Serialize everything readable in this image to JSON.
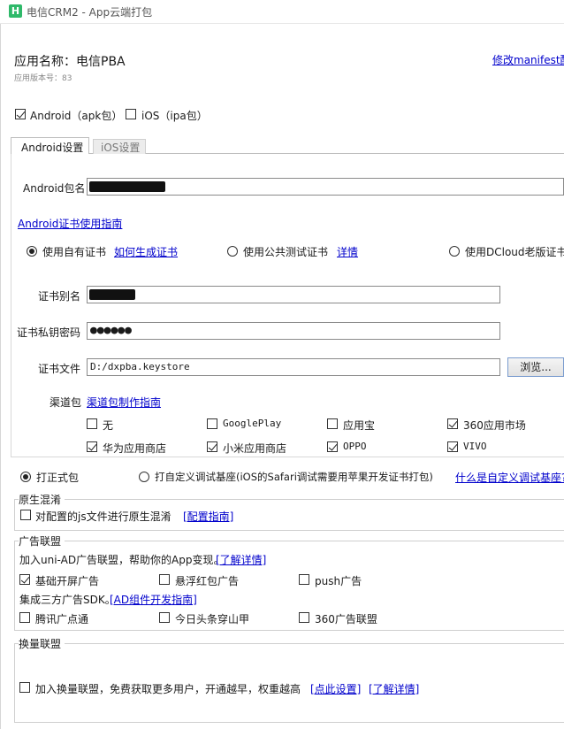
{
  "window": {
    "title": "电信CRM2 - App云端打包",
    "logo_letter": "H"
  },
  "header": {
    "app_name": "应用名称：电信PBA",
    "version": "应用版本号：83",
    "manifest_link": "修改manifest配置"
  },
  "platforms": {
    "android": {
      "label": "Android（apk包）",
      "checked": true
    },
    "ios": {
      "label": "iOS（ipa包）",
      "checked": false
    }
  },
  "tabs": [
    {
      "label": "Android设置",
      "active": true
    },
    {
      "label": "iOS设置",
      "active": false
    }
  ],
  "android": {
    "package_label": "Android包名",
    "package_value": "",
    "cert_guide_link": "Android证书使用指南",
    "cert_options": [
      {
        "label": "使用自有证书",
        "link": "如何生成证书",
        "checked": true
      },
      {
        "label": "使用公共测试证书",
        "link": "详情",
        "checked": false
      },
      {
        "label": "使用DCloud老版证书",
        "checked": false
      }
    ],
    "alias_label": "证书别名",
    "alias_value": "",
    "password_label": "证书私钥密码",
    "password_value": "●●●●●●",
    "file_label": "证书文件",
    "file_value": "D:/dxpba.keystore",
    "browse_button": "浏览...",
    "channel_label": "渠道包",
    "channel_link": "渠道包制作指南",
    "channels": [
      {
        "label": "无",
        "checked": false
      },
      {
        "label": "GooglePlay",
        "checked": false
      },
      {
        "label": "应用宝",
        "checked": false
      },
      {
        "label": "360应用市场",
        "checked": true
      },
      {
        "label": "华为应用商店",
        "checked": true
      },
      {
        "label": "小米应用商店",
        "checked": true
      },
      {
        "label": "OPPO",
        "checked": true
      },
      {
        "label": "VIVO",
        "checked": true
      }
    ]
  },
  "build_type": {
    "formal": {
      "label": "打正式包",
      "checked": true
    },
    "debug": {
      "label": "打自定义调试基座(iOS的Safari调试需要用苹果开发证书打包)",
      "checked": false
    },
    "debug_link": "什么是自定义调试基座?"
  },
  "obfuscation": {
    "title": "原生混淆",
    "checkbox_label": "对配置的js文件进行原生混淆",
    "link": "[配置指南]"
  },
  "ad": {
    "title": "广告联盟",
    "intro": "加入uni-AD广告联盟，帮助你的App变现。",
    "intro_link": "[了解详情]",
    "options": [
      {
        "label": "基础开屏广告",
        "checked": true
      },
      {
        "label": "悬浮红包广告",
        "checked": false
      },
      {
        "label": "push广告",
        "checked": false
      }
    ],
    "sdk_intro": "集成三方广告SDK。",
    "sdk_link": "[AD组件开发指南]",
    "sdk_options": [
      {
        "label": "腾讯广点通",
        "checked": false
      },
      {
        "label": "今日头条穿山甲",
        "checked": false
      },
      {
        "label": "360广告联盟",
        "checked": false
      }
    ]
  },
  "exchange": {
    "title": "换量联盟",
    "checkbox_label": "加入换量联盟，免费获取更多用户，开通越早，权重越高",
    "link_settings": "[点此设置]",
    "link_details": "[了解详情]"
  }
}
